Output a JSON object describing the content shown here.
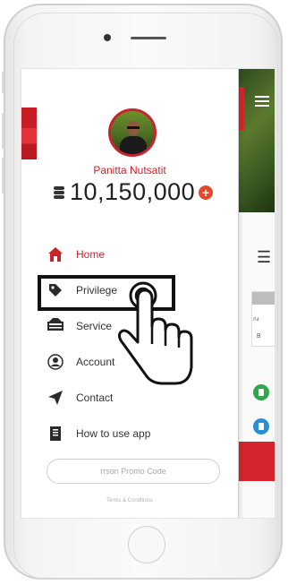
{
  "drawer": {
    "user_name": "Panitta Nutsatit",
    "balance": "10,150,000",
    "add_symbol": "+",
    "menu": [
      {
        "label": "Home",
        "icon": "home-icon",
        "active": true
      },
      {
        "label": "Privilege",
        "icon": "tag-icon",
        "active": false
      },
      {
        "label": "Service",
        "icon": "service-icon",
        "active": false
      },
      {
        "label": "Account",
        "icon": "user-icon",
        "active": false
      },
      {
        "label": "Contact",
        "icon": "paper-plane-icon",
        "active": false
      },
      {
        "label": "How to use app",
        "icon": "book-icon",
        "active": false
      }
    ],
    "promo_placeholder": "rrson Promo Code",
    "terms": "Terms & Conditions"
  },
  "background_app": {
    "card_text_1": "ก่ง",
    "card_text_2": "B"
  },
  "colors": {
    "accent": "#c9242b",
    "highlight_border": "#111111",
    "green_dot": "#2ea84a",
    "blue_dot": "#2a8fd6"
  }
}
